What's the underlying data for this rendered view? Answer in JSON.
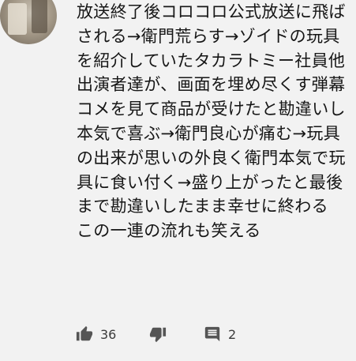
{
  "comment": {
    "lines": [
      "放送終了後コロコロ公式放送に飛ば",
      "される→衛門荒らす→ゾイドの玩具",
      "を紹介していたタカラトミー社員他",
      "出演者達が、画面を埋め尽くす弾幕",
      "コメを見て商品が受けたと勘違いし",
      "本気で喜ぶ→衛門良心が痛む→玩具",
      "の出来が思いの外良く衛門本気で玩",
      "具に食い付く→盛り上がったと最後",
      "まで勘違いしたまま幸せに終わる",
      "この一連の流れも笑える"
    ]
  },
  "actions": {
    "like_icon": "thumbs-up-icon",
    "like_count": "36",
    "dislike_icon": "thumbs-down-icon",
    "reply_icon": "comment-icon",
    "reply_count": "2"
  },
  "colors": {
    "background": "#f2f2f2",
    "text": "#161616",
    "icon": "#555555"
  }
}
